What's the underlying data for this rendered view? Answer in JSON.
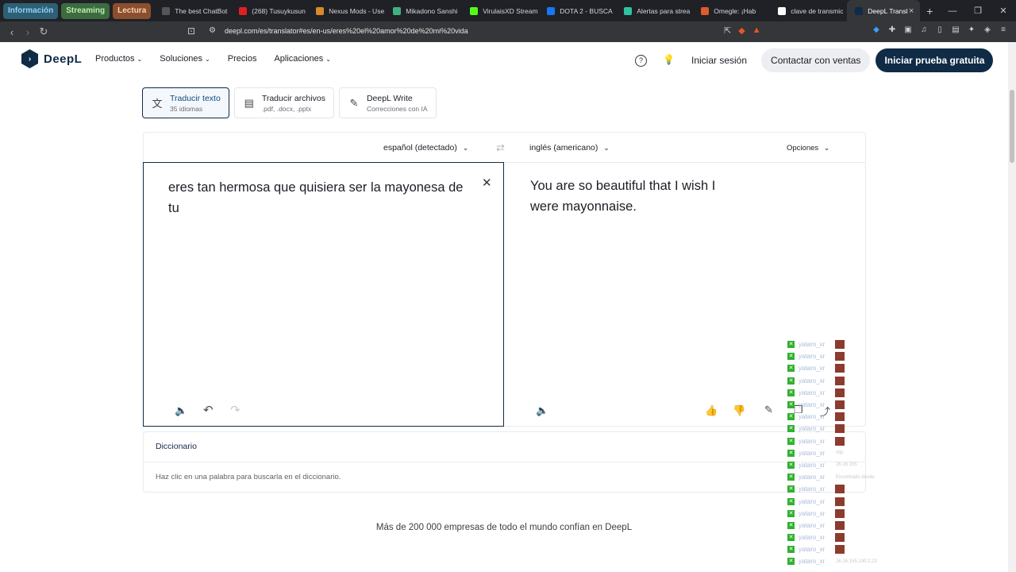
{
  "browser": {
    "tab_groups": [
      {
        "label": "Información",
        "bg": "#2e5f73",
        "fg": "#8fd3ff"
      },
      {
        "label": "Streaming",
        "bg": "#3d6b3f",
        "fg": "#b9f0ad"
      },
      {
        "label": "Lectura",
        "bg": "#8a4f2f",
        "fg": "#ffd2b3"
      }
    ],
    "tabs": [
      {
        "title": "The best ChatBot",
        "icon": "chatbot-icon",
        "color": "#555"
      },
      {
        "title": "(268) Tusuykusun",
        "icon": "youtube-icon",
        "color": "#e02020"
      },
      {
        "title": "Nexus Mods - Use",
        "icon": "nexus-icon",
        "color": "#d98a2b"
      },
      {
        "title": "Mikadono Sanshi",
        "icon": "vue-icon",
        "color": "#3fb27f"
      },
      {
        "title": "VirulaisXD Stream",
        "icon": "kick-icon",
        "color": "#53fc18"
      },
      {
        "title": "DOTA 2 - BUSCA",
        "icon": "facebook-icon",
        "color": "#1877f2"
      },
      {
        "title": "Alertas para strea",
        "icon": "alerts-icon",
        "color": "#2ec4a0"
      },
      {
        "title": "Omegle: ¡Hab",
        "icon": "omegle-icon",
        "color": "#e05a2b"
      },
      {
        "title": "clave de transmic",
        "icon": "google-icon",
        "color": "#ffffff"
      },
      {
        "title": "DeepL Transl",
        "icon": "deepl-icon",
        "color": "#0f2b46",
        "active": true
      }
    ],
    "url": "deepl.com/es/translator#es/en-us/eres%20el%20amor%20de%20mi%20vida"
  },
  "header": {
    "logo_text": "DeepL",
    "nav": [
      {
        "label": "Productos",
        "has_menu": true
      },
      {
        "label": "Soluciones",
        "has_menu": true
      },
      {
        "label": "Precios",
        "has_menu": false
      },
      {
        "label": "Aplicaciones",
        "has_menu": true
      }
    ],
    "signin": "Iniciar sesión",
    "contact_sales": "Contactar con ventas",
    "free_trial": "Iniciar prueba gratuita"
  },
  "modes": [
    {
      "title": "Traducir texto",
      "subtitle": "35 idiomas",
      "icon": "translate-icon",
      "active": true
    },
    {
      "title": "Traducir archivos",
      "subtitle": ".pdf, .docx, .pptx",
      "icon": "file-icon",
      "active": false
    },
    {
      "title": "DeepL Write",
      "subtitle": "Correcciones con IA",
      "icon": "magic-wand-icon",
      "active": false
    }
  ],
  "translator": {
    "source_lang": "español (detectado)",
    "target_lang": "inglés (americano)",
    "options": "Opciones",
    "source_text": "eres tan hermosa que quisiera ser la mayonesa de tu",
    "target_text": "You are so beautiful that I wish I were mayonnaise."
  },
  "dictionary": {
    "title": "Diccionario",
    "hint": "Haz clic en una palabra para buscarla en el diccionario."
  },
  "trust_line": "Más de 200 000 empresas de todo el mundo confían en DeepL",
  "overlay": {
    "rows": [
      {
        "name": "yataro_xr",
        "extra": ""
      },
      {
        "name": "yataro_xr",
        "extra": ""
      },
      {
        "name": "yataro_xr",
        "extra": ""
      },
      {
        "name": "yataro_xr",
        "extra": ""
      },
      {
        "name": "yataro_xr",
        "extra": ""
      },
      {
        "name": "yataro_xr",
        "extra": ""
      },
      {
        "name": "yataro_xr",
        "extra": ""
      },
      {
        "name": "yataro_xr",
        "extra": ""
      },
      {
        "name": "yataro_xr",
        "extra": ""
      },
      {
        "name": "yataro_xr",
        "extra": "clip"
      },
      {
        "name": "yataro_xr",
        "extra": "26.16.155"
      },
      {
        "name": "yataro_xr",
        "extra": "Encontrado desde"
      },
      {
        "name": "yataro_xr",
        "extra": ""
      },
      {
        "name": "yataro_xr",
        "extra": ""
      },
      {
        "name": "yataro_xr",
        "extra": ""
      },
      {
        "name": "yataro_xr",
        "extra": ""
      },
      {
        "name": "yataro_xr",
        "extra": ""
      },
      {
        "name": "yataro_xr",
        "extra": ""
      },
      {
        "name": "yataro_xr",
        "extra": "26.16.155.100:2.23"
      }
    ]
  }
}
